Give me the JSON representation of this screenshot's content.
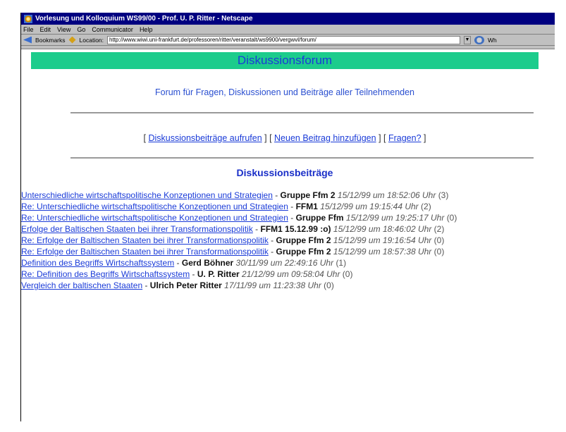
{
  "window": {
    "title": "Vorlesung und Kolloquium WS99/00 - Prof. U. P. Ritter - Netscape"
  },
  "menu": [
    "File",
    "Edit",
    "View",
    "Go",
    "Communicator",
    "Help"
  ],
  "location_bar": {
    "bookmarks_label": "Bookmarks",
    "location_label": "Location:",
    "url": "http://www.wiwi.uni-frankfurt.de/professoren/ritter/veranstalt/ws9900/vergwvl/forum/",
    "whats_related_label": "Wh"
  },
  "page": {
    "banner": "Diskussionsforum",
    "subtitle": "Forum für Fragen, Diskussionen und Beiträge aller Teilnehmenden",
    "actions": [
      "Diskussionsbeiträge aufrufen",
      "Neuen Beitrag hinzufügen",
      "Fragen?"
    ],
    "section_title": "Diskussionsbeiträge"
  },
  "threads": [
    {
      "title": "Unterschiedliche wirtschaftspolitische Konzeptionen und Strategien",
      "author": "Gruppe Ffm 2",
      "date": "15/12/99 um 18:52:06 Uhr",
      "count": "(3)",
      "replies": [
        {
          "title": "Re: Unterschiedliche wirtschaftspolitische Konzeptionen und Strategien",
          "author": "FFM1",
          "date": "15/12/99 um 19:15:44 Uhr",
          "count": "(2)",
          "replies": [
            {
              "title": "Re: Unterschiedliche wirtschaftspolitische Konzeptionen und Strategien",
              "author": "Gruppe Ffm",
              "date": "15/12/99 um 19:25:17 Uhr",
              "count": "(0)"
            }
          ]
        }
      ]
    },
    {
      "title": "Erfolge der Baltischen Staaten bei ihrer Transformationspolitik",
      "author": "FFM1 15.12.99 :o)",
      "date": "15/12/99 um 18:46:02 Uhr",
      "count": "(2)",
      "replies": [
        {
          "title": "Re: Erfolge der Baltischen Staaten bei ihrer Transformationspolitik",
          "author": "Gruppe Ffm 2",
          "date": "15/12/99 um 19:16:54 Uhr",
          "count": "(0)"
        },
        {
          "title": "Re: Erfolge der Baltischen Staaten bei ihrer Transformationspolitik",
          "author": "Gruppe Ffm 2",
          "date": "15/12/99 um 18:57:38 Uhr",
          "count": "(0)"
        }
      ]
    },
    {
      "title": "Definition des Begriffs Wirtschaftssystem",
      "author": "Gerd Böhner",
      "date": "30/11/99 um 22:49:16 Uhr",
      "count": "(1)",
      "replies": [
        {
          "title": "Re: Definition des Begriffs Wirtschaftssystem",
          "author": "U. P. Ritter",
          "date": "21/12/99 um 09:58:04 Uhr",
          "count": "(0)"
        }
      ]
    },
    {
      "title": "Vergleich der baltischen Staaten",
      "author": "Ulrich Peter Ritter",
      "date": "17/11/99 um 11:23:38 Uhr",
      "count": "(0)"
    }
  ],
  "colors": {
    "banner_bg": "#1ccc8c",
    "link": "#1a3bd8",
    "titlebar": "#000080"
  }
}
